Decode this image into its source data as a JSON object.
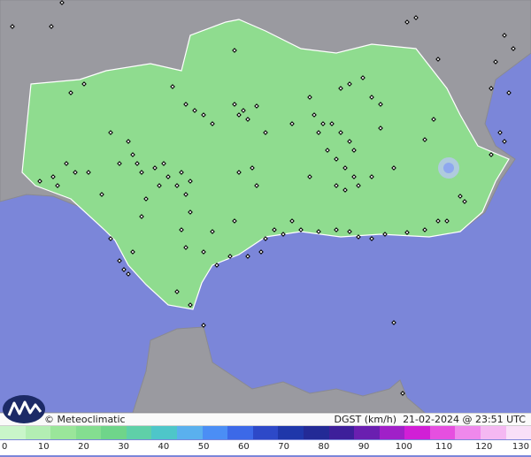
{
  "info_bar": {
    "brand": "© Meteoclimatic",
    "variable": "DGST (km/h)",
    "timestamp": "21-02-2024 @ 23:51 UTC"
  },
  "legend": {
    "ticks": [
      "0",
      "10",
      "20",
      "30",
      "40",
      "50",
      "60",
      "70",
      "80",
      "90",
      "100",
      "110",
      "120",
      "130"
    ],
    "colors": [
      "#c9f5c9",
      "#b3eeb3",
      "#9ae69a",
      "#84de90",
      "#6fd58a",
      "#5fd0a8",
      "#4ec6c9",
      "#5ab0ee",
      "#4b8ef5",
      "#3c69e8",
      "#2d49c8",
      "#1f37aa",
      "#232a96",
      "#3d1f9a",
      "#6a1fb0",
      "#a020c8",
      "#d11fd6",
      "#e64fe0",
      "#ef88ec",
      "#f5b8f2",
      "#f9dff8"
    ]
  },
  "map": {
    "colors": {
      "sea": "#7b86d9",
      "land_outside": "#9a9aa0",
      "region": "#8fdc8f"
    },
    "stations_shown": true
  }
}
